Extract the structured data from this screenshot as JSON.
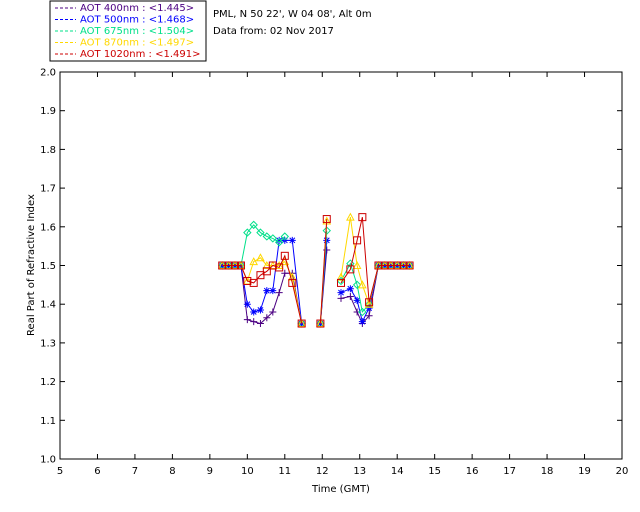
{
  "header": {
    "location": "PML, N 50 22', W 04 08', Alt 0m",
    "date_line": "Data from: 02 Nov 2017"
  },
  "legend": [
    {
      "label": "AOT  400nm : <1.445>",
      "color": "#4b0082"
    },
    {
      "label": "AOT  500nm : <1.468>",
      "color": "#0000ff"
    },
    {
      "label": "AOT  675nm : <1.504>",
      "color": "#00e08a"
    },
    {
      "label": "AOT  870nm : <1.497>",
      "color": "#ffd800"
    },
    {
      "label": "AOT 1020nm : <1.491>",
      "color": "#cc0000"
    }
  ],
  "chart_data": {
    "type": "line",
    "xlabel": "Time (GMT)",
    "ylabel": "Real Part of Refractive Index",
    "xlim": [
      5,
      20
    ],
    "ylim": [
      1.0,
      2.0
    ],
    "x_ticks": [
      "5",
      "6",
      "7",
      "8",
      "9",
      "10",
      "11",
      "12",
      "13",
      "14",
      "15",
      "16",
      "17",
      "18",
      "19",
      "20"
    ],
    "y_ticks": [
      "1.0",
      "1.1",
      "1.2",
      "1.3",
      "1.4",
      "1.5",
      "1.6",
      "1.7",
      "1.8",
      "1.9",
      "2.0"
    ],
    "grid": false,
    "series": [
      {
        "name": "AOT  400nm : <1.445>",
        "color": "#4b0082",
        "marker": "plus",
        "points": [
          [
            9.33,
            1.5
          ],
          [
            9.5,
            1.5
          ],
          [
            9.67,
            1.5
          ],
          [
            9.83,
            1.5
          ],
          [
            10.0,
            1.36
          ],
          [
            10.17,
            1.355
          ],
          [
            10.35,
            1.35
          ],
          [
            10.52,
            1.365
          ],
          [
            10.68,
            1.38
          ],
          [
            10.85,
            1.43
          ],
          [
            11.0,
            1.48
          ],
          [
            11.2,
            1.48
          ],
          [
            11.45,
            1.35
          ],
          [
            11.95,
            1.35
          ],
          [
            12.12,
            1.54
          ],
          [
            12.5,
            1.415
          ],
          [
            12.75,
            1.42
          ],
          [
            12.93,
            1.38
          ],
          [
            13.07,
            1.35
          ],
          [
            13.25,
            1.37
          ],
          [
            13.5,
            1.5
          ],
          [
            13.67,
            1.5
          ],
          [
            13.83,
            1.5
          ],
          [
            14.0,
            1.5
          ],
          [
            14.17,
            1.5
          ],
          [
            14.33,
            1.5
          ]
        ]
      },
      {
        "name": "AOT  500nm : <1.468>",
        "color": "#0000ff",
        "marker": "asterisk",
        "points": [
          [
            9.33,
            1.5
          ],
          [
            9.5,
            1.5
          ],
          [
            9.67,
            1.5
          ],
          [
            9.83,
            1.5
          ],
          [
            10.0,
            1.4
          ],
          [
            10.17,
            1.38
          ],
          [
            10.35,
            1.385
          ],
          [
            10.52,
            1.435
          ],
          [
            10.68,
            1.435
          ],
          [
            10.85,
            1.565
          ],
          [
            11.0,
            1.565
          ],
          [
            11.2,
            1.565
          ],
          [
            11.45,
            1.35
          ],
          [
            11.95,
            1.35
          ],
          [
            12.12,
            1.565
          ],
          [
            12.5,
            1.43
          ],
          [
            12.75,
            1.44
          ],
          [
            12.93,
            1.41
          ],
          [
            13.07,
            1.355
          ],
          [
            13.25,
            1.39
          ],
          [
            13.5,
            1.5
          ],
          [
            13.67,
            1.5
          ],
          [
            13.83,
            1.5
          ],
          [
            14.0,
            1.5
          ],
          [
            14.17,
            1.5
          ],
          [
            14.33,
            1.5
          ]
        ]
      },
      {
        "name": "AOT  675nm : <1.504>",
        "color": "#00e08a",
        "marker": "diamond",
        "points": [
          [
            9.33,
            1.5
          ],
          [
            9.5,
            1.5
          ],
          [
            9.67,
            1.5
          ],
          [
            9.83,
            1.5
          ],
          [
            10.0,
            1.585
          ],
          [
            10.17,
            1.605
          ],
          [
            10.35,
            1.585
          ],
          [
            10.52,
            1.575
          ],
          [
            10.68,
            1.57
          ],
          [
            10.85,
            1.56
          ],
          [
            11.0,
            1.575
          ],
          [
            11.45,
            1.35
          ],
          [
            11.95,
            1.35
          ],
          [
            12.12,
            1.59
          ],
          [
            12.5,
            1.46
          ],
          [
            12.75,
            1.505
          ],
          [
            12.93,
            1.45
          ],
          [
            13.07,
            1.38
          ],
          [
            13.25,
            1.4
          ],
          [
            13.5,
            1.5
          ],
          [
            13.67,
            1.5
          ],
          [
            13.83,
            1.5
          ],
          [
            14.0,
            1.5
          ],
          [
            14.17,
            1.5
          ],
          [
            14.33,
            1.5
          ]
        ]
      },
      {
        "name": "AOT  870nm : <1.497>",
        "color": "#ffd800",
        "marker": "triangle",
        "points": [
          [
            9.33,
            1.5
          ],
          [
            9.5,
            1.5
          ],
          [
            9.67,
            1.5
          ],
          [
            9.83,
            1.5
          ],
          [
            10.0,
            1.46
          ],
          [
            10.17,
            1.51
          ],
          [
            10.35,
            1.52
          ],
          [
            10.52,
            1.5
          ],
          [
            10.68,
            1.5
          ],
          [
            10.85,
            1.5
          ],
          [
            11.0,
            1.51
          ],
          [
            11.2,
            1.47
          ],
          [
            11.45,
            1.35
          ],
          [
            11.95,
            1.35
          ],
          [
            12.12,
            1.615
          ],
          [
            12.5,
            1.47
          ],
          [
            12.75,
            1.625
          ],
          [
            12.93,
            1.5
          ],
          [
            13.07,
            1.45
          ],
          [
            13.25,
            1.4
          ],
          [
            13.5,
            1.5
          ],
          [
            13.67,
            1.5
          ],
          [
            13.83,
            1.5
          ],
          [
            14.0,
            1.5
          ],
          [
            14.17,
            1.5
          ],
          [
            14.33,
            1.5
          ]
        ]
      },
      {
        "name": "AOT 1020nm : <1.491>",
        "color": "#cc0000",
        "marker": "square",
        "points": [
          [
            9.33,
            1.5
          ],
          [
            9.5,
            1.5
          ],
          [
            9.67,
            1.5
          ],
          [
            9.83,
            1.5
          ],
          [
            10.0,
            1.46
          ],
          [
            10.17,
            1.455
          ],
          [
            10.35,
            1.475
          ],
          [
            10.52,
            1.485
          ],
          [
            10.68,
            1.5
          ],
          [
            10.85,
            1.495
          ],
          [
            11.0,
            1.525
          ],
          [
            11.2,
            1.455
          ],
          [
            11.45,
            1.35
          ],
          [
            11.95,
            1.35
          ],
          [
            12.12,
            1.62
          ],
          [
            12.5,
            1.455
          ],
          [
            12.75,
            1.49
          ],
          [
            12.93,
            1.565
          ],
          [
            13.07,
            1.625
          ],
          [
            13.25,
            1.405
          ],
          [
            13.5,
            1.5
          ],
          [
            13.67,
            1.5
          ],
          [
            13.83,
            1.5
          ],
          [
            14.0,
            1.5
          ],
          [
            14.17,
            1.5
          ],
          [
            14.33,
            1.5
          ]
        ]
      }
    ]
  }
}
